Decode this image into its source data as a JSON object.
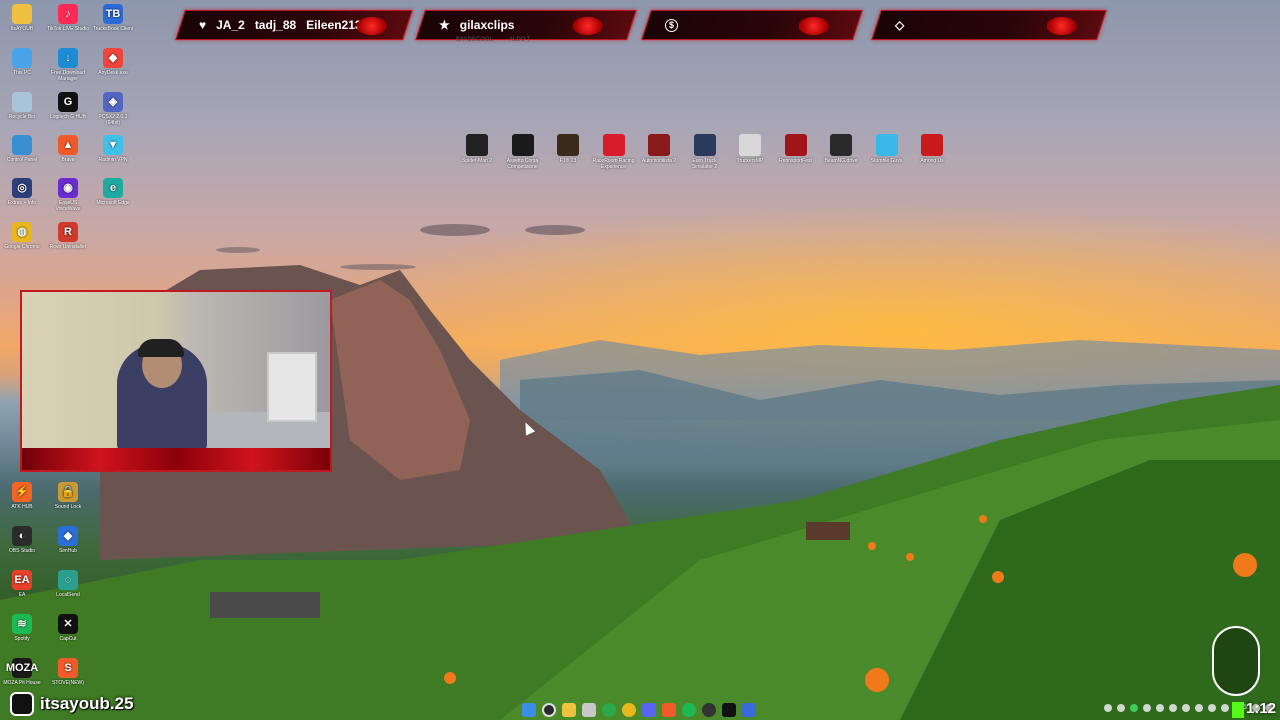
{
  "desktop_icons": [
    {
      "label": "ItsAYOUB",
      "color": "#f0c040",
      "glyph": ""
    },
    {
      "label": "TikTok LIVE Studio",
      "color": "#fe2c55",
      "glyph": "♪"
    },
    {
      "label": "TrucksBook Client",
      "color": "#2d6ad8",
      "glyph": "TB"
    },
    {
      "label": "This PC",
      "color": "#4aa3e8",
      "glyph": ""
    },
    {
      "label": "Free Download Manager",
      "color": "#1e8bd6",
      "glyph": "↓"
    },
    {
      "label": "AnyDesk.exe",
      "color": "#ef443b",
      "glyph": "◆"
    },
    {
      "label": "Recycle Bin",
      "color": "#a9c4d8",
      "glyph": ""
    },
    {
      "label": "Logitech G HUB",
      "color": "#111111",
      "glyph": "G"
    },
    {
      "label": "PCSX2 2.0.2 (64bit)",
      "color": "#5366c4",
      "glyph": "◈"
    },
    {
      "label": "Control Panel",
      "color": "#3a8fd0",
      "glyph": ""
    },
    {
      "label": "Brave",
      "color": "#f05a28",
      "glyph": "▲"
    },
    {
      "label": "Radmin VPN",
      "color": "#3fc0e8",
      "glyph": "▼"
    },
    {
      "label": "Extras + Info",
      "color": "#2c3f7a",
      "glyph": "◎"
    },
    {
      "label": "EaseUS VoiceWave",
      "color": "#6b2bd1",
      "glyph": "◉"
    },
    {
      "label": "Microsoft Edge",
      "color": "#1faa9f",
      "glyph": "e"
    },
    {
      "label": "Google Chrome",
      "color": "#e8b61d",
      "glyph": "◍"
    },
    {
      "label": "Revo Uninstaller",
      "color": "#d03a2b",
      "glyph": "R"
    },
    {
      "label": "ATK HUB",
      "color": "#f26522",
      "glyph": "⚡"
    },
    {
      "label": "Sound Lock",
      "color": "#c89a35",
      "glyph": "🔒"
    },
    {
      "label": "OBS Studio",
      "color": "#2b2b2b",
      "glyph": "◐"
    },
    {
      "label": "SimHub",
      "color": "#2a6fd8",
      "glyph": "◆"
    },
    {
      "label": "EA",
      "color": "#e8402a",
      "glyph": "EA"
    },
    {
      "label": "LocalSend",
      "color": "#2a9f8f",
      "glyph": "◌"
    },
    {
      "label": "Spotify",
      "color": "#1db954",
      "glyph": "≋"
    },
    {
      "label": "CapCut",
      "color": "#111111",
      "glyph": "✕"
    },
    {
      "label": "MOZA Pit House",
      "color": "#1a1a1a",
      "glyph": "MOZA"
    },
    {
      "label": "STOVE(NEW)",
      "color": "#f25a2b",
      "glyph": "S"
    }
  ],
  "top_games": [
    {
      "label": "Spider-Man 2",
      "color": "#222222"
    },
    {
      "label": "Assetto Corsa Competizione",
      "color": "#1a1a1a"
    },
    {
      "label": "F1® 23",
      "color": "#3a2a1a"
    },
    {
      "label": "RaceRoom Racing Experience",
      "color": "#d81c2a"
    },
    {
      "label": "Automobilista 2",
      "color": "#8a1a1a"
    },
    {
      "label": "Euro Truck Simulator 2",
      "color": "#2a3a5a"
    },
    {
      "label": "TruckersMP",
      "color": "#d8d8d8"
    },
    {
      "label": "RennsportFest",
      "color": "#a0141a"
    },
    {
      "label": "BeamNG.drive",
      "color": "#2a2a2a"
    },
    {
      "label": "Stumble Guys",
      "color": "#3ab8e8"
    },
    {
      "label": "Among Us",
      "color": "#c81a1a"
    }
  ],
  "alerts": {
    "follows": {
      "icon": "heart-icon",
      "text": "JA_2   tadj_88   Eileen213"
    },
    "star": {
      "icon": "star-icon",
      "text": "gilaxclips",
      "subtext": "BAYDECOOL          ALDO T"
    },
    "donation": {
      "icon": "dollar-icon",
      "text": ""
    },
    "diamond": {
      "icon": "diamond-icon",
      "text": ""
    }
  },
  "brand": {
    "handle": "itsayoub.25"
  },
  "clock": {
    "time": "1:12"
  },
  "tray": {
    "lang": "ENG"
  },
  "colors": {
    "accent": "#c21820"
  }
}
